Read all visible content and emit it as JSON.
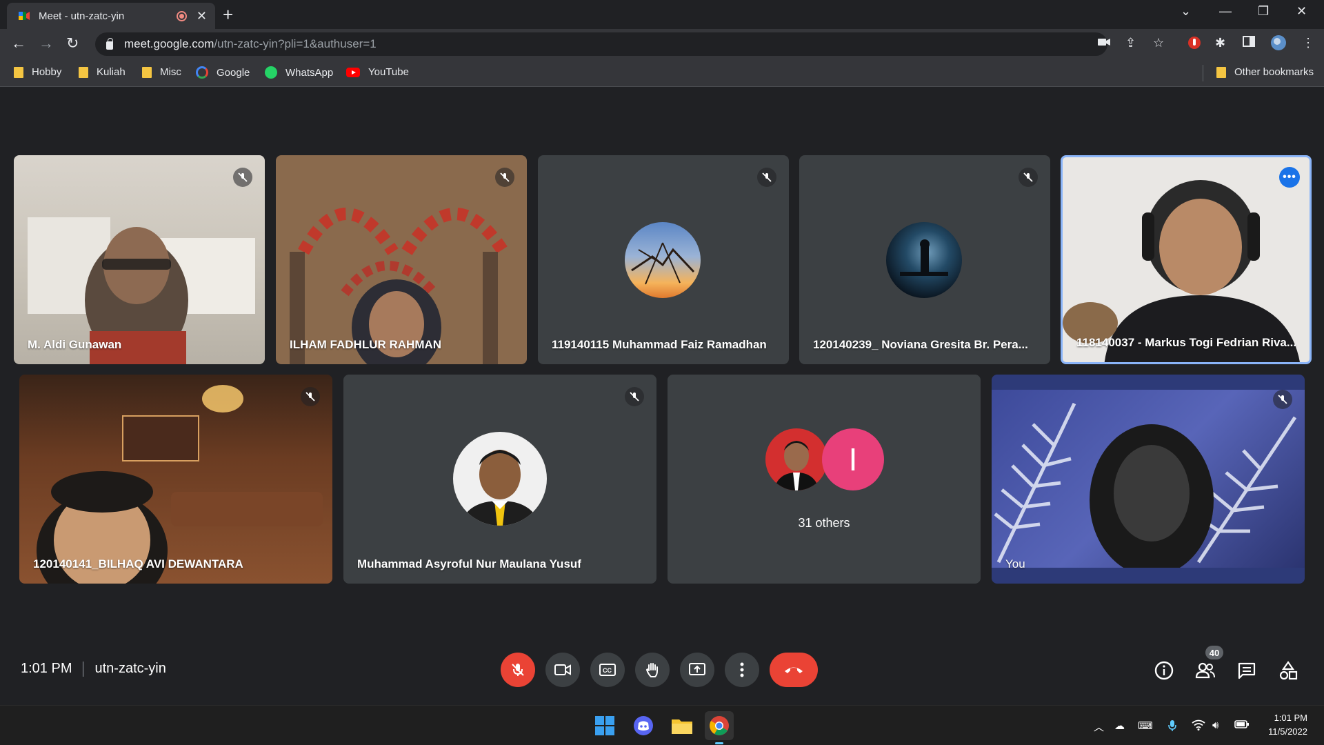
{
  "browser": {
    "tab_title": "Meet - utn-zatc-yin",
    "url_host": "meet.google.com",
    "url_path": "/utn-zatc-yin?pli=1&authuser=1",
    "bookmarks": [
      "Hobby",
      "Kuliah",
      "Misc",
      "Google",
      "WhatsApp",
      "YouTube"
    ],
    "other_bookmarks": "Other bookmarks"
  },
  "participants": [
    {
      "name": "M. Aldi Gunawan",
      "muted": true
    },
    {
      "name": "ILHAM FADHLUR RAHMAN",
      "muted": true
    },
    {
      "name": "119140115 Muhammad Faiz Ramadhan",
      "muted": true
    },
    {
      "name": "120140239_ Noviana Gresita Br. Pera...",
      "muted": true
    },
    {
      "name": "118140037 - Markus Togi Fedrian Riva...",
      "speaking": true
    },
    {
      "name": "120140141_BILHAQ AVI DEWANTARA",
      "muted": true
    },
    {
      "name": "Muhammad Asyroful Nur Maulana Yusuf",
      "muted": true
    },
    {
      "name": "31 others",
      "others_initial": "I"
    },
    {
      "name": "You",
      "muted": true
    }
  ],
  "meeting": {
    "time": "1:01 PM",
    "code": "utn-zatc-yin",
    "participant_count": "40"
  },
  "taskbar": {
    "time": "1:01 PM",
    "date": "11/5/2022"
  },
  "colors": {
    "end_call": "#ea4335",
    "speaking_border": "#8ab4f8",
    "tile_bg": "#3c4043",
    "page_bg": "#202124"
  }
}
